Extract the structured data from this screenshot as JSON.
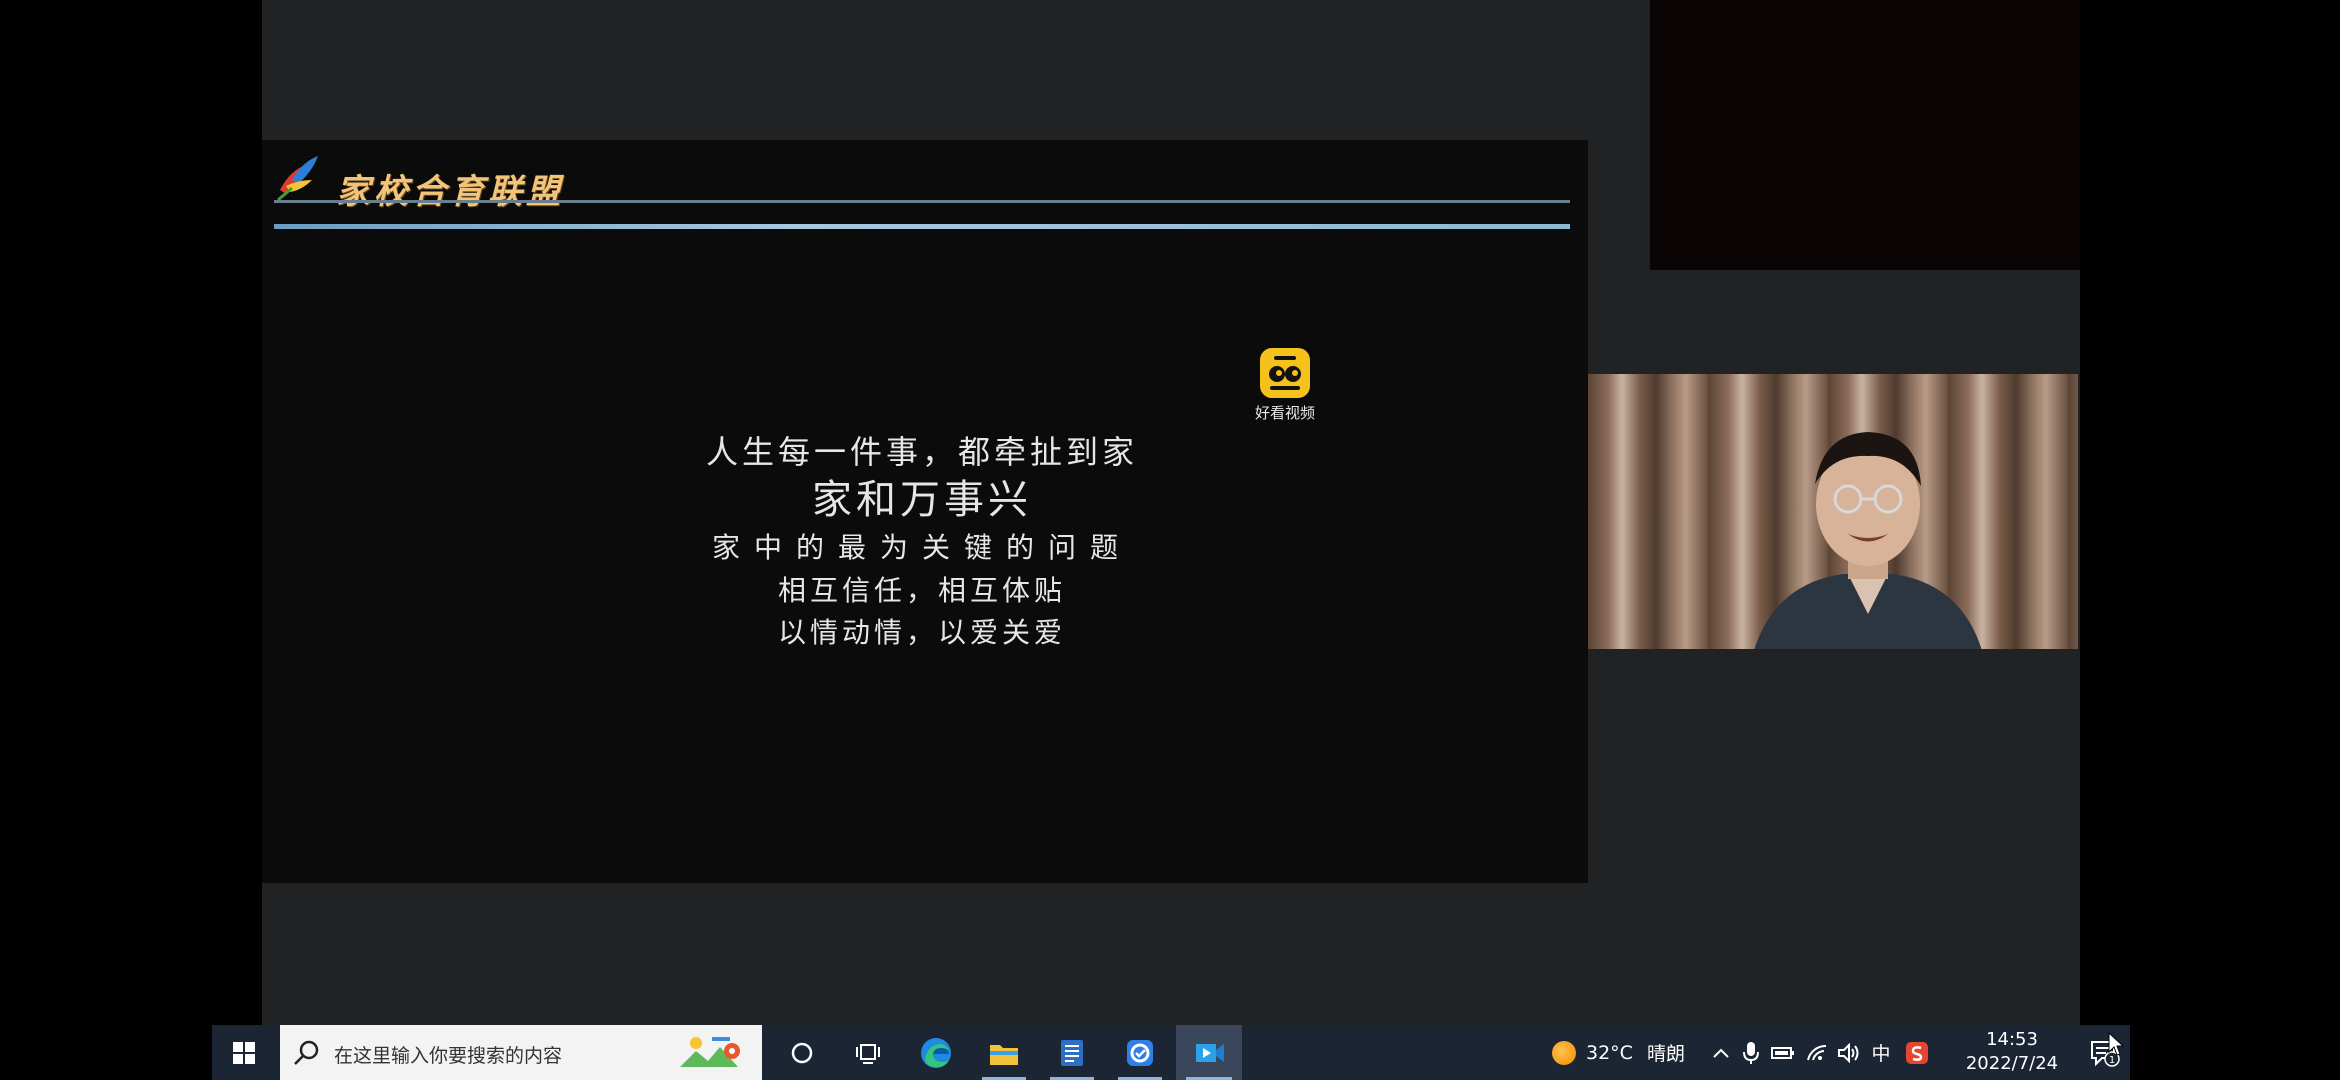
{
  "slide": {
    "header": "家校合育联盟",
    "watermark_label": "好看视频",
    "lines": [
      "人生每一件事，都牵扯到家",
      "家和万事兴",
      "家中的最为关键的问题",
      "相互信任，相互体贴",
      "以情动情，以爱关爱"
    ]
  },
  "taskbar": {
    "search_placeholder": "在这里输入你要搜索的内容",
    "weather_temp": "32°C",
    "weather_condition": "晴朗",
    "ime_label": "中",
    "clock_time": "14:53",
    "clock_date": "2022/7/24",
    "notification_count": "1"
  },
  "colors": {
    "taskbar_bg": "#1c2533",
    "slide_header": "#f2c47a",
    "accent_line": "#8fb4e0"
  }
}
